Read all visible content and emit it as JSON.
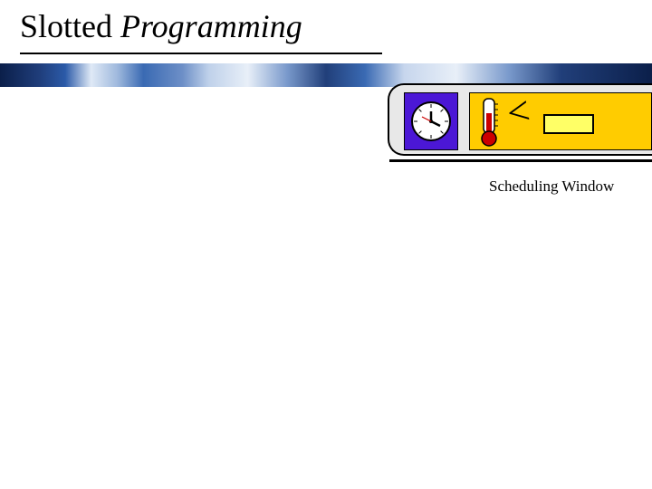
{
  "title": {
    "word1": "Slotted ",
    "word2": "Programming"
  },
  "compare_symbol": "<",
  "label": "Scheduling Window"
}
